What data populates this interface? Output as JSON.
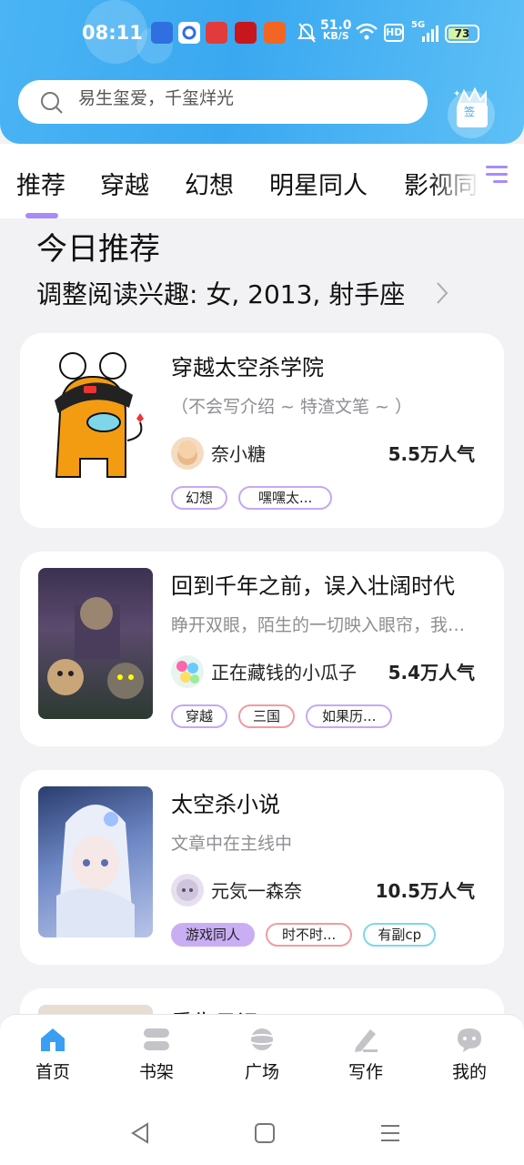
{
  "status_bar": {
    "time": "08:11",
    "net_speed_value": "51.0",
    "net_speed_unit": "KB/S",
    "hd_label": "HD",
    "signal_label": "5G",
    "battery_level": "73"
  },
  "search": {
    "placeholder": "易生玺爱，千玺烊光"
  },
  "sign_button": {
    "label": "签"
  },
  "tabs": [
    {
      "label": "推荐",
      "active": true
    },
    {
      "label": "穿越"
    },
    {
      "label": "幻想"
    },
    {
      "label": "明星同人"
    },
    {
      "label": "影视同人"
    }
  ],
  "section": {
    "title": "今日推荐",
    "subtitle": "调整阅读兴趣: 女, 2013, 射手座"
  },
  "books": [
    {
      "title": "穿越太空杀学院",
      "desc": "（不会写介绍 ~ 特渣文笔 ~ ）",
      "author": "奈小糖",
      "popularity": "5.5万人气",
      "tags": [
        {
          "label": "幻想",
          "style": "purple"
        },
        {
          "label": "嘿嘿太...",
          "style": "purple"
        }
      ]
    },
    {
      "title": "回到千年之前，误入壮阔时代",
      "desc": "睁开双眼，陌生的一切映入眼帘，我该怎么办",
      "author": "正在藏钱的小瓜子",
      "popularity": "5.4万人气",
      "tags": [
        {
          "label": "穿越",
          "style": "purple"
        },
        {
          "label": "三国",
          "style": "red"
        },
        {
          "label": "如果历...",
          "style": "purple"
        }
      ]
    },
    {
      "title": "太空杀小说",
      "desc": "文章中在主线中",
      "author": "元気一森奈",
      "popularity": "10.5万人气",
      "tags": [
        {
          "label": "游戏同人",
          "style": "filled"
        },
        {
          "label": "时不时...",
          "style": "red"
        },
        {
          "label": "有副cp",
          "style": "blue"
        }
      ]
    },
    {
      "title": "重生日记"
    }
  ],
  "bottom_nav": [
    {
      "label": "首页",
      "icon": "home-icon",
      "active": true
    },
    {
      "label": "书架",
      "icon": "bookshelf-icon"
    },
    {
      "label": "广场",
      "icon": "planet-icon"
    },
    {
      "label": "写作",
      "icon": "pen-icon"
    },
    {
      "label": "我的",
      "icon": "chat-face-icon"
    }
  ],
  "colors": {
    "header_blue": "#3aa8f0",
    "accent_purple": "#a78bfa",
    "nav_active": "#3a9ff2",
    "nav_inactive": "#c4c4c8"
  }
}
